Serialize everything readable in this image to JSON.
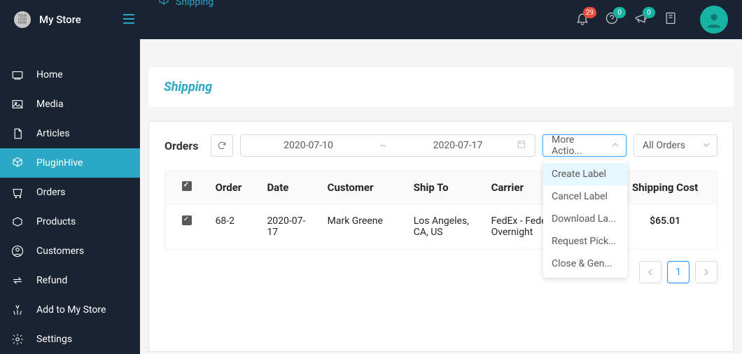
{
  "brand": {
    "logo_text": "YOUR LOGO HERE",
    "store_name": "My Store"
  },
  "breadcrumb": {
    "label": "Shipping"
  },
  "notifications": {
    "bell_count": "29",
    "help_count": "0",
    "announce_count": "0"
  },
  "sidebar": {
    "items": [
      {
        "label": "Home"
      },
      {
        "label": "Media"
      },
      {
        "label": "Articles"
      },
      {
        "label": "PluginHive"
      },
      {
        "label": "Orders"
      },
      {
        "label": "Products"
      },
      {
        "label": "Customers"
      },
      {
        "label": "Refund"
      },
      {
        "label": "Add to My Store"
      },
      {
        "label": "Settings"
      }
    ]
  },
  "page": {
    "title": "Shipping"
  },
  "orders": {
    "title": "Orders",
    "date_from": "2020-07-10",
    "date_to": "2020-07-17",
    "date_sep": "~",
    "more_actions_label": "More Actio...",
    "all_orders_label": "All Orders",
    "more_actions_menu": [
      "Create Label",
      "Cancel Label",
      "Download La...",
      "Request Pick...",
      "Close & Gen..."
    ],
    "columns": {
      "order": "Order",
      "date": "Date",
      "customer": "Customer",
      "shipto": "Ship To",
      "carrier": "Carrier",
      "cost": "Shipping Cost"
    },
    "rows": [
      {
        "order": "68-2",
        "date": "2020-07-17",
        "customer": "Mark Greene",
        "shipto": "Los Angeles, CA, US",
        "carrier": "FedEx - Fedex Priority Overnight",
        "cost": "$65.01"
      }
    ],
    "pagination": {
      "current": "1"
    }
  }
}
